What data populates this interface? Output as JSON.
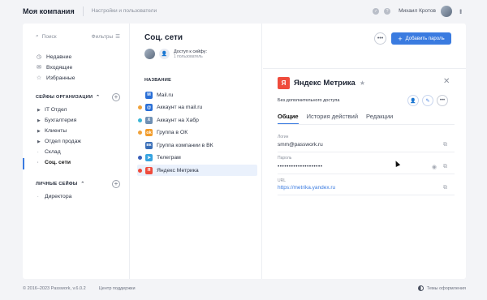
{
  "topbar": {
    "brand": "Моя компания",
    "settings_link": "Настройки и пользователи",
    "username": "Михаил Кротов"
  },
  "sidebar": {
    "search_placeholder": "Поиск",
    "filters_label": "Фильтры",
    "nav": [
      {
        "label": "Недавние",
        "icon": "clock-icon"
      },
      {
        "label": "Входящие",
        "icon": "inbox-icon"
      },
      {
        "label": "Избранные",
        "icon": "star-icon"
      }
    ],
    "org_section": "СЕЙФЫ ОРГАНИЗАЦИИ",
    "org_folders": [
      "IT Отдел",
      "Бухгалтерия",
      "Клиенты",
      "Отдел продаж",
      "Склад",
      "Соц. сети"
    ],
    "personal_section": "ЛИЧНЫЕ СЕЙФЫ",
    "personal_folders": [
      "Директора"
    ]
  },
  "list": {
    "title": "Соц. сети",
    "access_line1": "Доступ к сейфу:",
    "access_line2": "1 пользователь",
    "column_header": "НАЗВАНИЕ",
    "items": [
      {
        "label": "Mail.ru",
        "icon_letter": "M",
        "icon_color": "#2a6fd6",
        "dot": ""
      },
      {
        "label": "Аккаунт на mail.ru",
        "icon_letter": "@",
        "icon_color": "#2a6fd6",
        "dot": "#f0a23b"
      },
      {
        "label": "Аккаунт на Хабр",
        "icon_letter": "Х",
        "icon_color": "#6e8fb3",
        "dot": "#3bb6d6"
      },
      {
        "label": "Группа в ОК",
        "icon_letter": "ok",
        "icon_color": "#f29c2b",
        "dot": "#f0a23b"
      },
      {
        "label": "Группа компании в ВК",
        "icon_letter": "вк",
        "icon_color": "#3a6fb8",
        "dot": ""
      },
      {
        "label": "Телеграм",
        "icon_letter": "➤",
        "icon_color": "#35a3e0",
        "dot": "#3a5fb8"
      },
      {
        "label": "Яндекс Метрика",
        "icon_letter": "Я",
        "icon_color": "#ef4b3c",
        "dot": "#ef4b3c"
      }
    ]
  },
  "detail": {
    "add_password": "Добавить пароль",
    "title": "Яндекс Метрика",
    "no_access": "Без дополнительного доступа",
    "tabs": [
      "Общие",
      "История действий",
      "Редакции"
    ],
    "login_label": "Логин",
    "login_value": "smm@passwork.ru",
    "password_label": "Пароль",
    "password_value": "••••••••••••••••••••",
    "url_label": "URL",
    "url_value": "https://metrika.yandex.ru"
  },
  "footer": {
    "copyright": "© 2016–2023 Passwork, v.6.0.2",
    "support": "Центр поддержки",
    "theme": "Темы оформления"
  }
}
